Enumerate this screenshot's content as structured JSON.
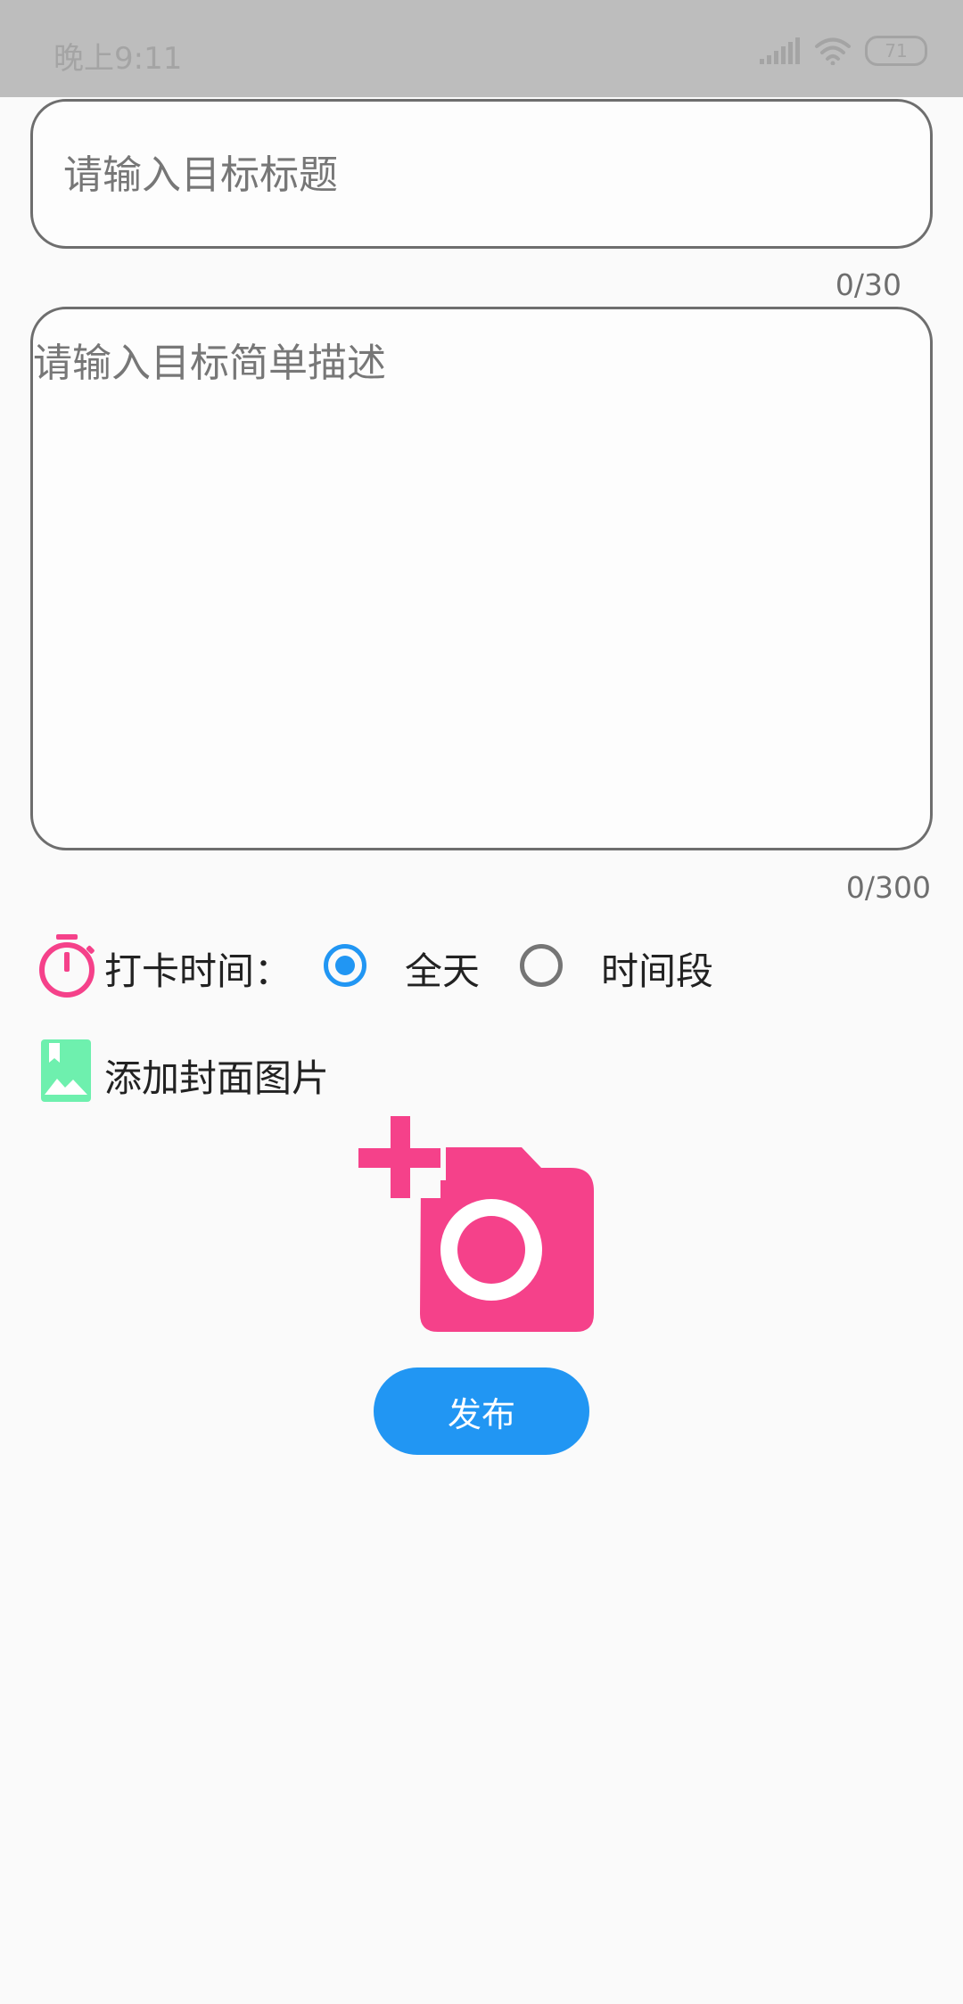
{
  "status_bar": {
    "time": "晚上9:11",
    "battery": "71",
    "icons": [
      "signal-icon",
      "wifi-icon",
      "battery-icon"
    ]
  },
  "form": {
    "title_placeholder": "请输入目标标题",
    "title_value": "",
    "title_counter": "0/30",
    "desc_placeholder": "请输入目标简单描述",
    "desc_value": "",
    "desc_counter": "0/300"
  },
  "checkin": {
    "label": "打卡时间：",
    "icon": "timer-icon",
    "options": [
      {
        "label": "全天",
        "selected": true
      },
      {
        "label": "时间段",
        "selected": false
      }
    ]
  },
  "cover": {
    "label": "添加封面图片",
    "icon": "picture-icon",
    "add_icon": "add-photo-icon"
  },
  "actions": {
    "publish_label": "发布"
  },
  "colors": {
    "accent": "#2196f3",
    "pink": "#f5418a",
    "green": "#6ef0ae",
    "status_bar": "#bdbdbd",
    "background": "#fafafa",
    "border": "#6e6e6e"
  }
}
